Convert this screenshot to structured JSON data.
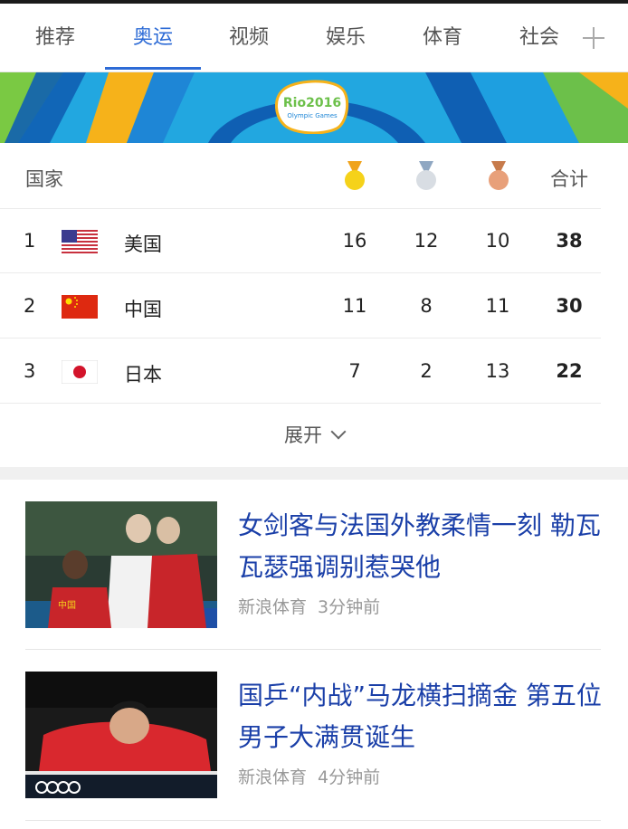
{
  "tabs": [
    {
      "label": "推荐",
      "active": false
    },
    {
      "label": "奥运",
      "active": true
    },
    {
      "label": "视频",
      "active": false
    },
    {
      "label": "娱乐",
      "active": false
    },
    {
      "label": "体育",
      "active": false
    },
    {
      "label": "社会",
      "active": false
    }
  ],
  "banner": {
    "logo_text": "Rio2016",
    "logo_sub": "Olympic Games"
  },
  "medal_table": {
    "headers": {
      "country": "国家",
      "total": "合计"
    },
    "medal_icons": [
      "gold-medal-icon",
      "silver-medal-icon",
      "bronze-medal-icon"
    ],
    "rows": [
      {
        "rank": "1",
        "country": "美国",
        "flag": "usa-flag",
        "gold": "16",
        "silver": "12",
        "bronze": "10",
        "total": "38"
      },
      {
        "rank": "2",
        "country": "中国",
        "flag": "china-flag",
        "gold": "11",
        "silver": "8",
        "bronze": "11",
        "total": "30"
      },
      {
        "rank": "3",
        "country": "日本",
        "flag": "japan-flag",
        "gold": "7",
        "silver": "2",
        "bronze": "13",
        "total": "22"
      }
    ],
    "expand_label": "展开"
  },
  "news": [
    {
      "title": "女剑客与法国外教柔情一刻 勒瓦瓦瑟强调别惹哭他",
      "source": "新浪体育",
      "time": "3分钟前"
    },
    {
      "title": "国乒“内战”马龙横扫摘金 第五位男子大满贯诞生",
      "source": "新浪体育",
      "time": "4分钟前"
    }
  ],
  "colors": {
    "accent": "#2d6bd6",
    "link": "#1a3fa8",
    "meta": "#999999"
  }
}
